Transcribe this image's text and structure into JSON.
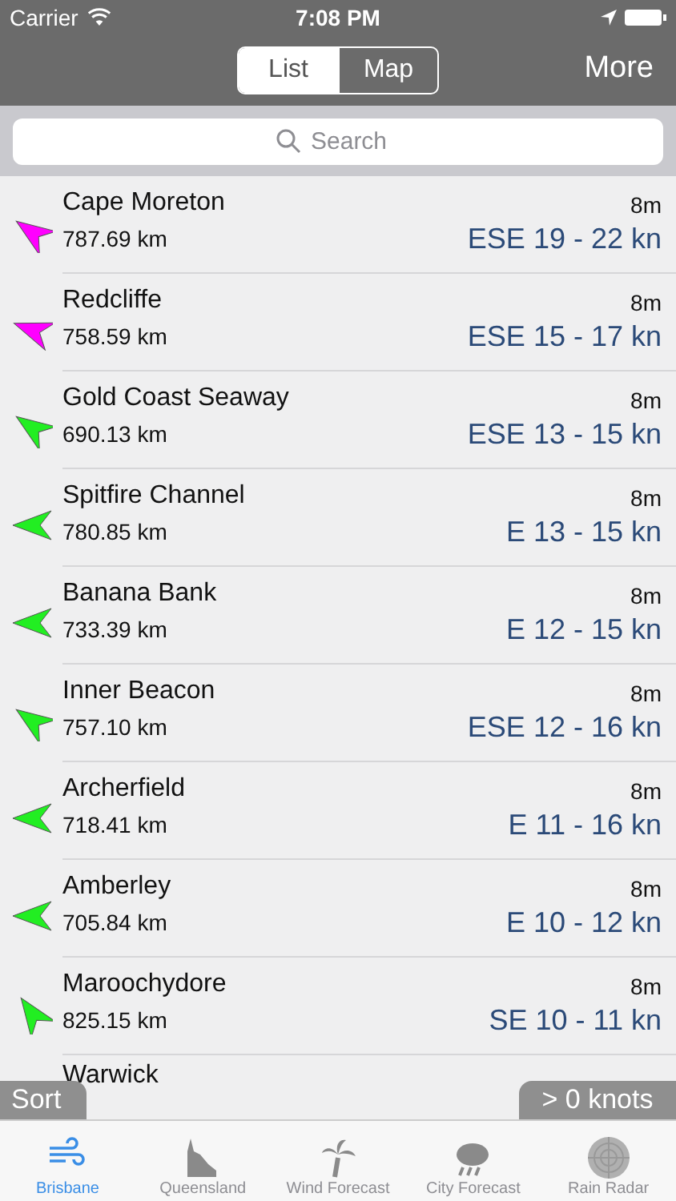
{
  "status_bar": {
    "carrier": "Carrier",
    "time": "7:08 PM"
  },
  "nav": {
    "segments": [
      {
        "label": "List",
        "selected": true
      },
      {
        "label": "Map",
        "selected": false
      }
    ],
    "more": "More"
  },
  "search": {
    "placeholder": "Search"
  },
  "stations": [
    {
      "name": "Cape Moreton",
      "age": "8m",
      "distance": "787.69 km",
      "wind": "ESE 19 - 22 kn",
      "color": "#ff00ff",
      "kind": "northwest"
    },
    {
      "name": "Redcliffe",
      "age": "8m",
      "distance": "758.59 km",
      "wind": "ESE 15 - 17 kn",
      "color": "#ff00ff",
      "kind": "westnorthwest"
    },
    {
      "name": "Gold Coast Seaway",
      "age": "8m",
      "distance": "690.13 km",
      "wind": "ESE 13 - 15 kn",
      "color": "#22ee22",
      "kind": "northwest"
    },
    {
      "name": "Spitfire Channel",
      "age": "8m",
      "distance": "780.85 km",
      "wind": "E 13 - 15 kn",
      "color": "#22ee22",
      "kind": "west"
    },
    {
      "name": "Banana Bank",
      "age": "8m",
      "distance": "733.39 km",
      "wind": "E 12 - 15 kn",
      "color": "#22ee22",
      "kind": "west"
    },
    {
      "name": "Inner Beacon",
      "age": "8m",
      "distance": "757.10 km",
      "wind": "ESE 12 - 16 kn",
      "color": "#22ee22",
      "kind": "northwest"
    },
    {
      "name": "Archerfield",
      "age": "8m",
      "distance": "718.41 km",
      "wind": "E 11 - 16 kn",
      "color": "#22ee22",
      "kind": "west"
    },
    {
      "name": "Amberley",
      "age": "8m",
      "distance": "705.84 km",
      "wind": "E 10 - 12 kn",
      "color": "#22ee22",
      "kind": "west"
    },
    {
      "name": "Maroochydore",
      "age": "8m",
      "distance": "825.15 km",
      "wind": "SE 10 - 11 kn",
      "color": "#22ee22",
      "kind": "northnorthwest"
    },
    {
      "name": "Warwick"
    }
  ],
  "overlays": {
    "sort": "Sort",
    "filter": "> 0 knots"
  },
  "tabs": [
    {
      "label": "Brisbane",
      "kind": "wind",
      "selected": true
    },
    {
      "label": "Queensland",
      "kind": "state",
      "selected": false
    },
    {
      "label": "Wind Forecast",
      "kind": "palm",
      "selected": false
    },
    {
      "label": "City Forecast",
      "kind": "cloud",
      "selected": false
    },
    {
      "label": "Rain Radar",
      "kind": "radar",
      "selected": false
    }
  ]
}
